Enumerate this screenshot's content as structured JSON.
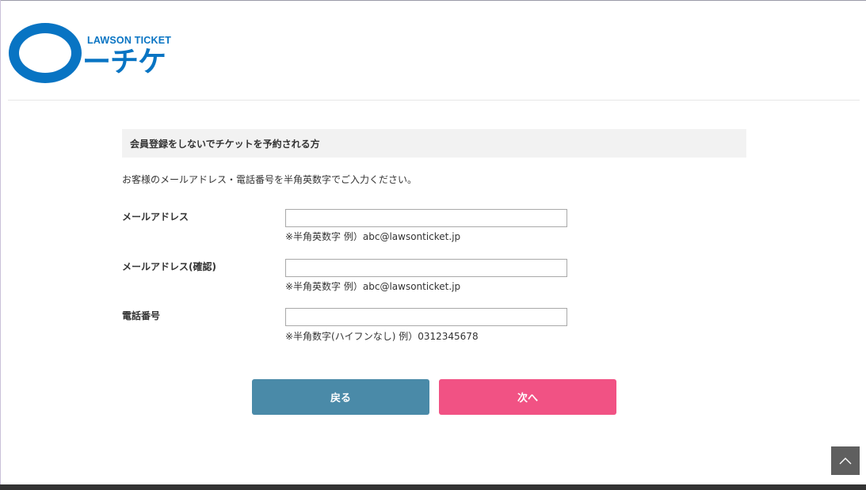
{
  "header": {
    "logo_subtext": "LAWSON TICKET",
    "logo_text": "ーチケ"
  },
  "form": {
    "heading": "会員登録をしないでチケットを予約される方",
    "instruction": "お客様のメールアドレス・電話番号を半角英数字でご入力ください。",
    "fields": [
      {
        "label": "メールアドレス",
        "value": "",
        "hint": "※半角英数字 例）abc@lawsonticket.jp"
      },
      {
        "label": "メールアドレス(確認)",
        "value": "",
        "hint": "※半角英数字 例）abc@lawsonticket.jp"
      },
      {
        "label": "電話番号",
        "value": "",
        "hint": "※半角数字(ハイフンなし) 例）0312345678"
      }
    ]
  },
  "buttons": {
    "back_label": "戻る",
    "next_label": "次へ"
  },
  "page_top": {
    "icon": "chevron-up-icon"
  },
  "colors": {
    "brand": "#0874c3",
    "back_button": "#4a8aa8",
    "next_button": "#f15284",
    "heading_bg": "#f2f2f2",
    "footer": "#333333"
  }
}
